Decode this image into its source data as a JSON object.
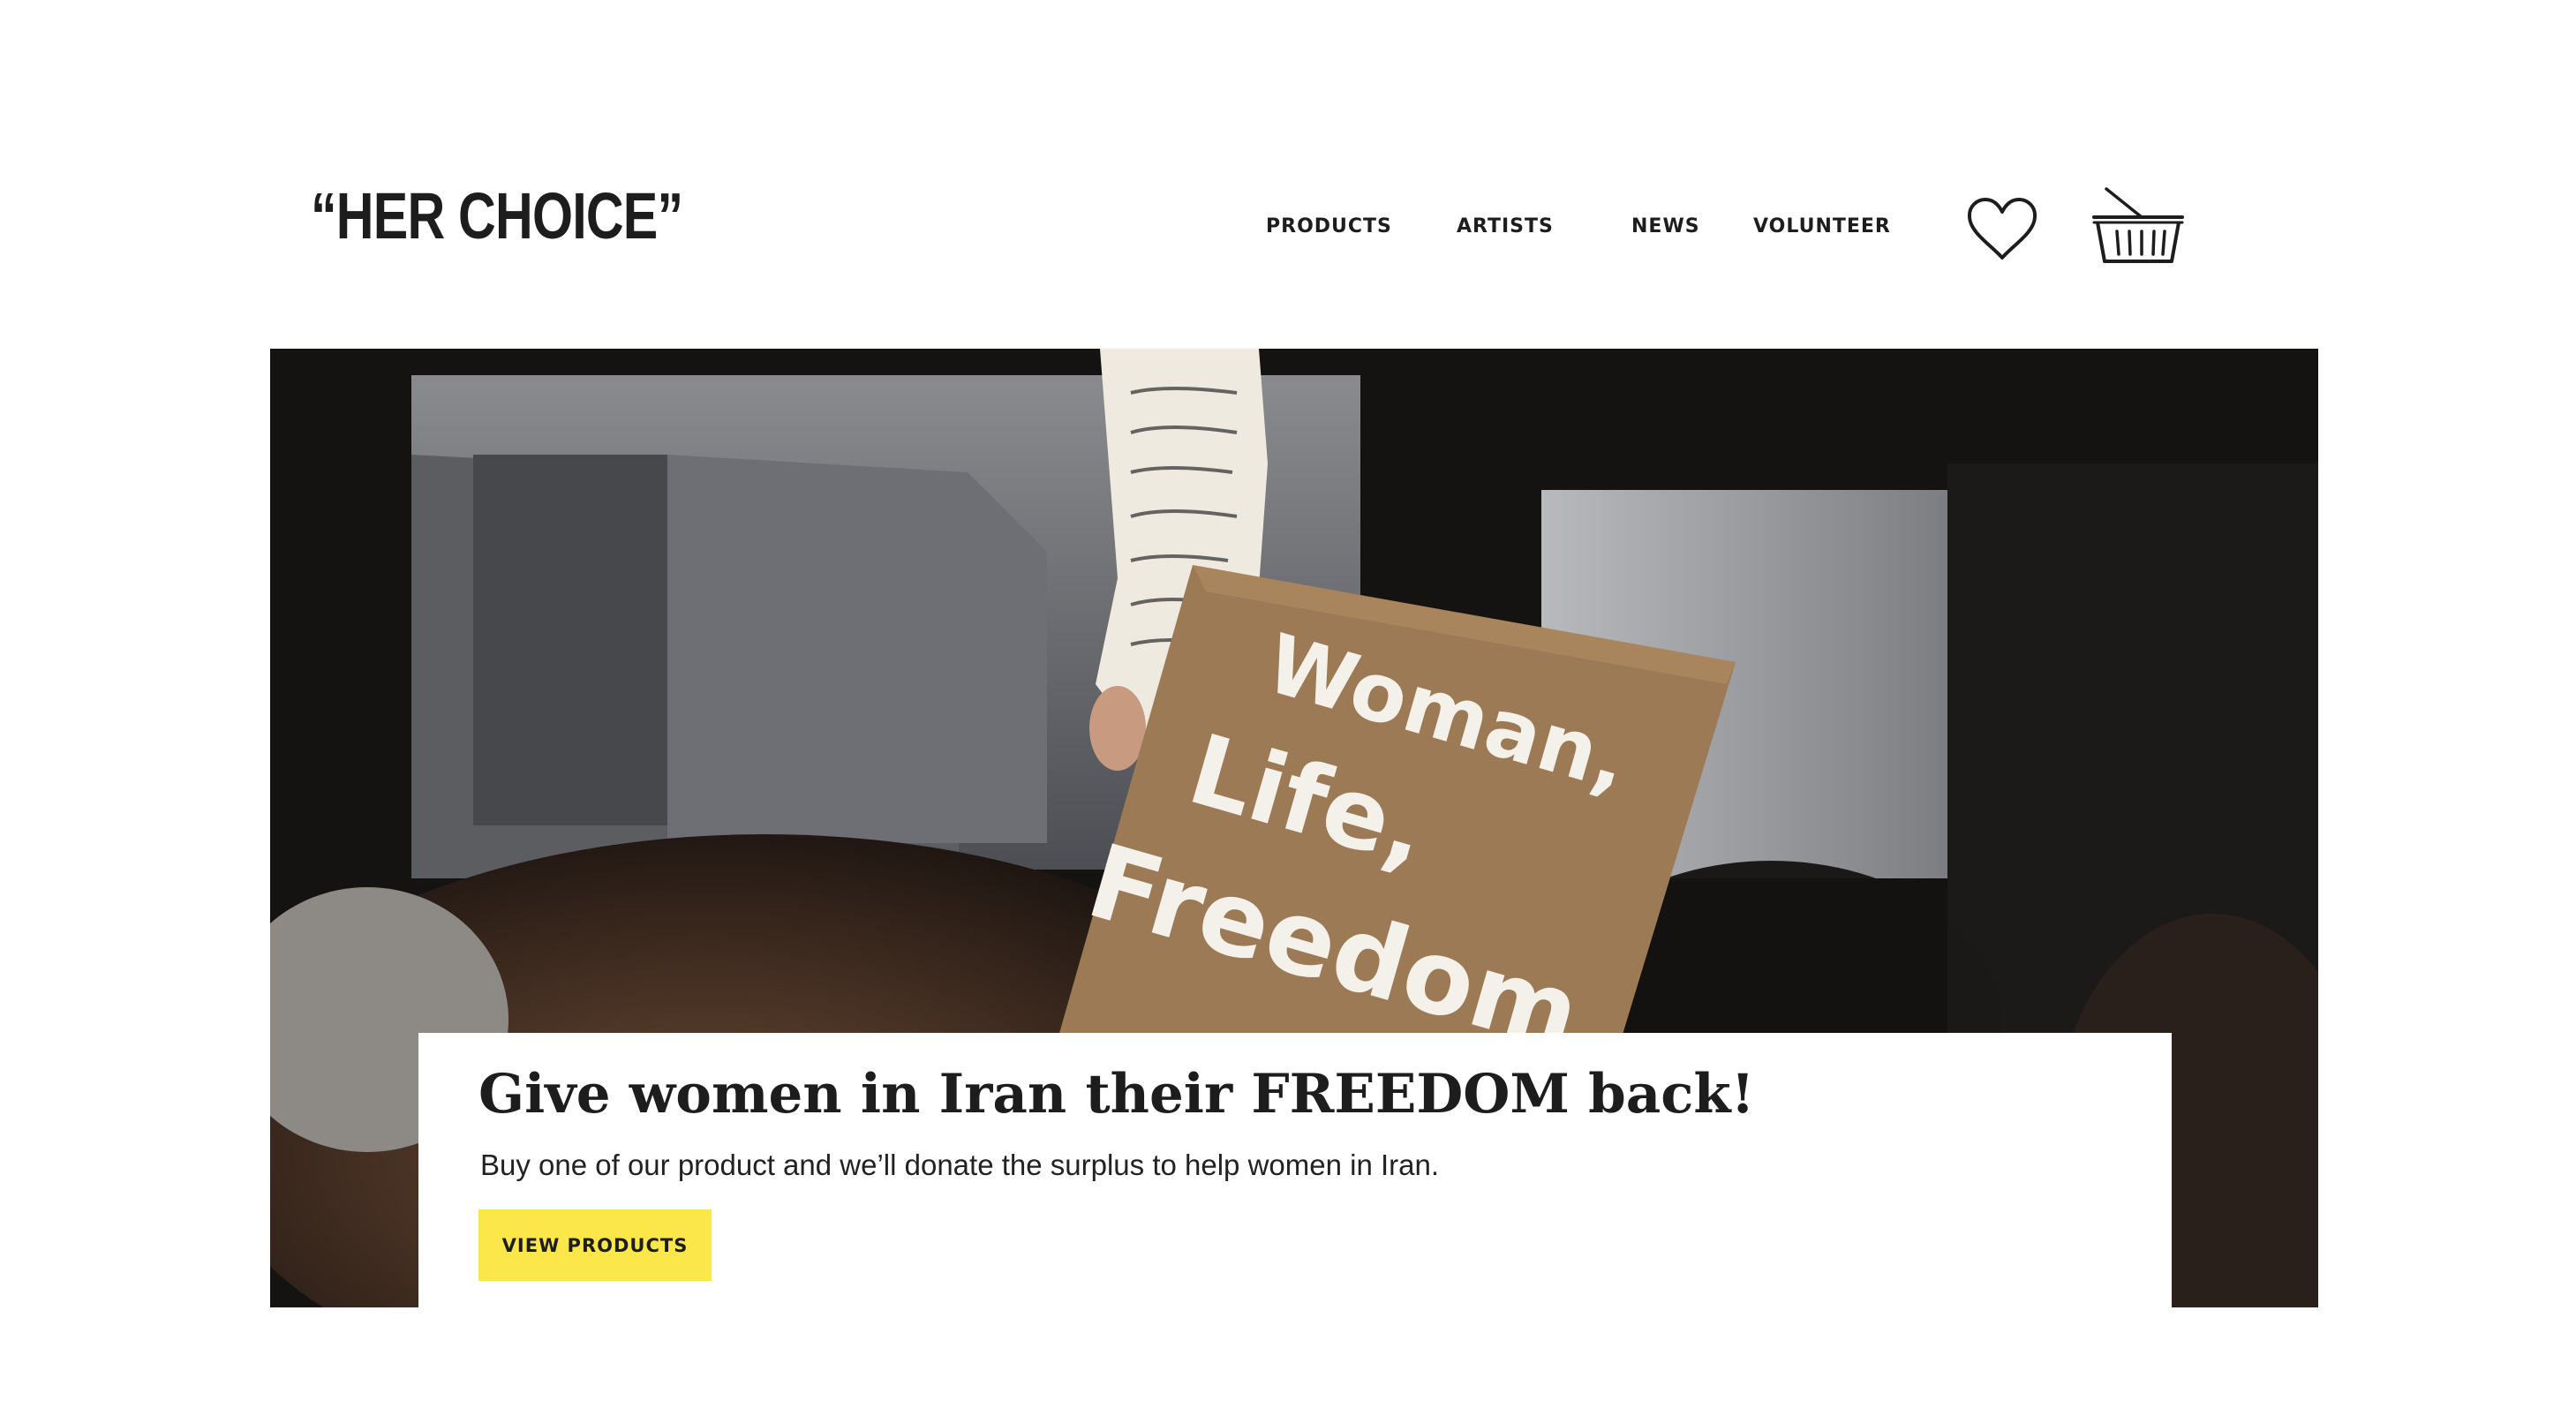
{
  "brand": {
    "logo_text": "“HER CHOICE”"
  },
  "nav": {
    "items": [
      {
        "label": "PRODUCTS"
      },
      {
        "label": "ARTISTS"
      },
      {
        "label": "NEWS"
      },
      {
        "label": "VOLUNTEER"
      }
    ]
  },
  "header_icons": {
    "favorites": "heart-icon",
    "cart": "basket-icon"
  },
  "hero": {
    "sign_lines": [
      "Woman,",
      "Life,",
      "Freedom"
    ],
    "title": "Give women in Iran their FREEDOM back!",
    "subtitle": "Buy one of our product and we’ll donate the surplus to help women in Iran.",
    "cta_label": "VIEW PRODUCTS"
  },
  "colors": {
    "cta_bg": "#fbe74a",
    "text": "#1d1d1d",
    "background": "#ffffff"
  }
}
